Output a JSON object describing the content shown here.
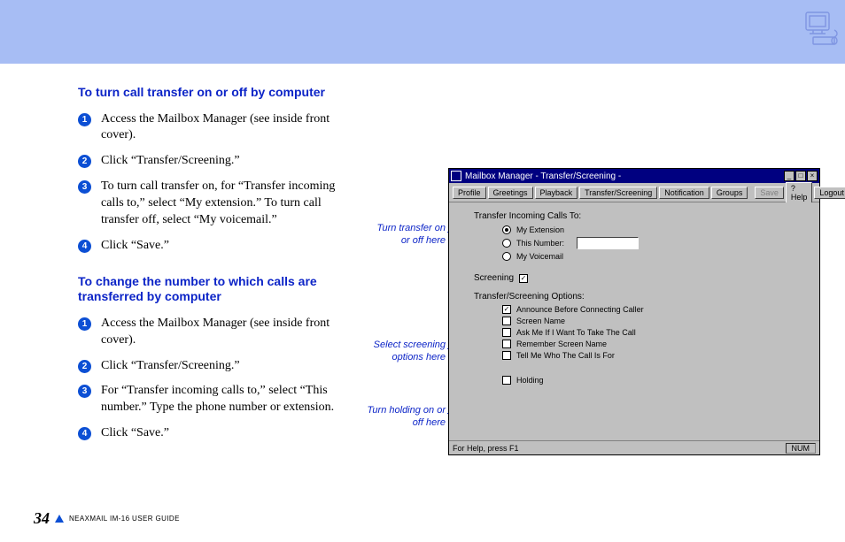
{
  "banner_icon_name": "computer-icon",
  "section1": {
    "heading": "To turn call transfer on or off by computer",
    "steps": [
      "Access the Mailbox Manager (see inside front cover).",
      "Click “Transfer/Screening.”",
      "To turn call transfer on, for “Transfer incoming calls to,” select “My extension.” To turn call transfer off, select “My voicemail.”",
      "Click “Save.”"
    ]
  },
  "section2": {
    "heading": "To change the number to which calls are transferred by computer",
    "steps": [
      "Access the Mailbox Manager (see inside front cover).",
      "Click “Transfer/Screening.”",
      "For “Transfer incoming calls to,” select “This number.” Type the phone number or extension.",
      "Click “Save.”"
    ]
  },
  "callouts": {
    "transfer": "Turn transfer on or off here",
    "screening": "Select screening options here",
    "holding": "Turn holding on or off here"
  },
  "screenshot": {
    "title": "Mailbox Manager - Transfer/Screening -",
    "toolbar": {
      "profile": "Profile",
      "greetings": "Greetings",
      "playback": "Playback",
      "transfer": "Transfer/Screening",
      "notification": "Notification",
      "groups": "Groups",
      "save": "Save",
      "help": "? Help",
      "logout": "Logout"
    },
    "labels": {
      "transfer_to": "Transfer Incoming Calls To:",
      "my_ext": "My Extension",
      "this_num": "This Number:",
      "my_vm": "My Voicemail",
      "screening": "Screening",
      "options_header": "Transfer/Screening Options:",
      "announce": "Announce Before Connecting Caller",
      "screen_name": "Screen Name",
      "ask": "Ask Me If I Want To Take The Call",
      "remember": "Remember Screen Name",
      "tell": "Tell Me Who The Call Is For",
      "holding": "Holding"
    },
    "statusbar": {
      "help": "For Help, press F1",
      "num": "NUM"
    }
  },
  "footer": {
    "page": "34",
    "guide": "NEAXMAIL IM-16 USER GUIDE"
  }
}
